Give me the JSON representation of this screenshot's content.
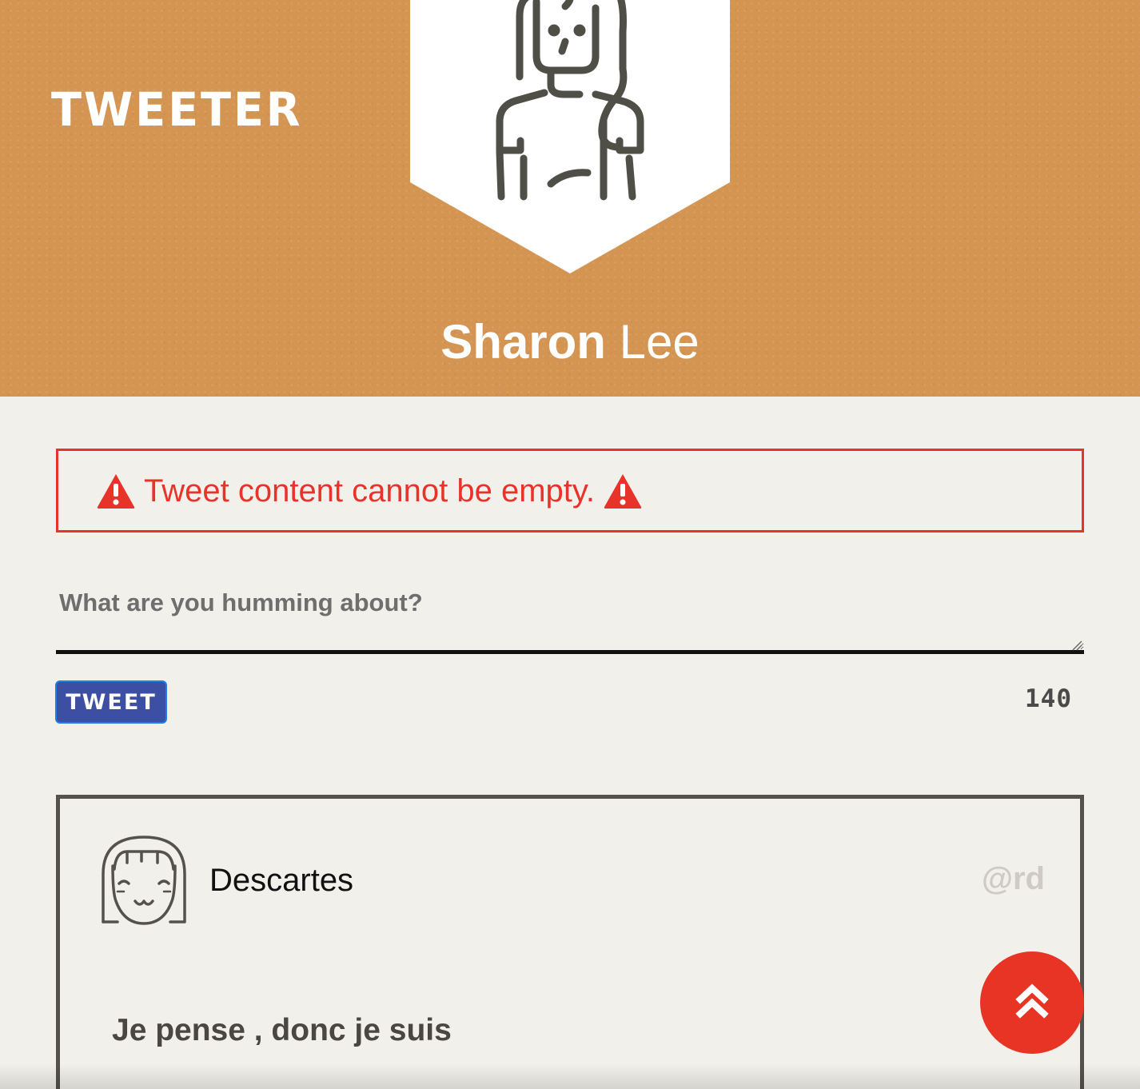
{
  "header": {
    "brand": "TWEETER",
    "user_first_name": "Sharon",
    "user_last_name": "Lee",
    "avatar_icon": "woman-avatar-icon"
  },
  "error": {
    "message": "Tweet content cannot be empty.",
    "icon": "warning-icon",
    "color": "#e8332a"
  },
  "compose": {
    "placeholder": "What are you humming about?",
    "value": "",
    "button_label": "TWEET",
    "char_count": "140"
  },
  "tweets": [
    {
      "avatar_icon": "girl-avatar-icon",
      "name": "Descartes",
      "handle": "@rd",
      "content": "Je pense , donc je suis"
    }
  ],
  "scroll_top": {
    "icon": "double-chevron-up-icon"
  },
  "colors": {
    "header_bg": "#d49553",
    "page_bg": "#f2f0eb",
    "accent_red": "#e83424",
    "button_blue": "#3d4fa3"
  }
}
